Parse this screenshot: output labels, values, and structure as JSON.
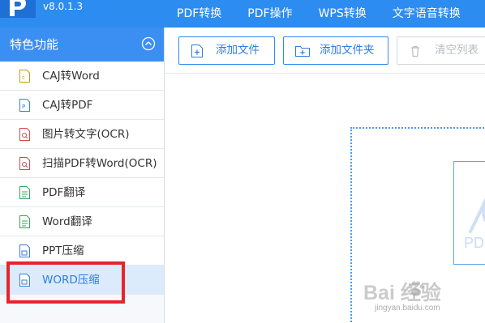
{
  "app": {
    "version": "v8.0.1.3",
    "brand_color": "#2d8cf0"
  },
  "topnav": {
    "items": [
      {
        "label": "PDF转换"
      },
      {
        "label": "PDF操作"
      },
      {
        "label": "WPS转换"
      },
      {
        "label": "文字语音转换"
      }
    ]
  },
  "sidebar": {
    "title": "特色功能",
    "items": [
      {
        "label": "CAJ转Word",
        "icon": "caj-file-icon",
        "active": false
      },
      {
        "label": "CAJ转PDF",
        "icon": "pdf-file-icon",
        "active": false
      },
      {
        "label": "图片转文字(OCR)",
        "icon": "image-ocr-file-icon",
        "active": false
      },
      {
        "label": "扫描PDF转Word(OCR)",
        "icon": "scan-ocr-file-icon",
        "active": false
      },
      {
        "label": "PDF翻译",
        "icon": "translate-file-icon",
        "active": false
      },
      {
        "label": "Word翻译",
        "icon": "translate-file-icon",
        "active": false
      },
      {
        "label": "PPT压缩",
        "icon": "compress-file-icon",
        "active": false
      },
      {
        "label": "WORD压缩",
        "icon": "compress-file-icon",
        "active": true
      }
    ],
    "highlight_color": "#e6242b"
  },
  "toolbar": {
    "add_file_label": "添加文件",
    "add_folder_label": "添加文件夹",
    "clear_list_label": "清空列表"
  },
  "main": {
    "preview_text": "PDF"
  },
  "watermark": {
    "main": "Bai  经验",
    "sub": "jingyan.baidu.com"
  }
}
